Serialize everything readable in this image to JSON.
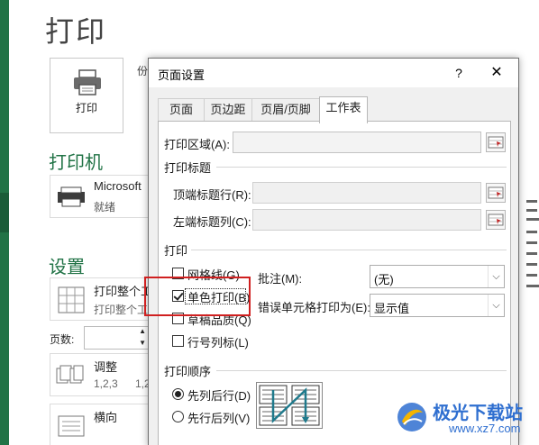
{
  "backstage": {
    "title": "打印",
    "print_button": "打印",
    "copies_label": "份",
    "printer_section": "打印机",
    "printer_name": "Microsoft",
    "printer_status": "就绪",
    "settings_section": "设置",
    "print_range_main": "打印整个工",
    "print_range_sub": "打印整个工",
    "pages_label": "页数:",
    "collate_main": "调整",
    "collate_sub": "1,2,3",
    "collate_sub2": "1,2",
    "orientation": "横向"
  },
  "dialog": {
    "title": "页面设置",
    "help_label": "?",
    "close_label": "✕",
    "tabs": [
      "页面",
      "页边距",
      "页眉/页脚",
      "工作表"
    ],
    "active_tab": "工作表",
    "print_area_label": "打印区域(A):",
    "print_titles_group": "打印标题",
    "rows_repeat_label": "顶端标题行(R):",
    "cols_repeat_label": "左端标题列(C):",
    "print_group": "打印",
    "gridlines_label": "网格线(G)",
    "gridlines_checked": false,
    "bw_label": "单色打印(B)",
    "bw_checked": true,
    "draft_label": "草稿品质(Q)",
    "draft_checked": false,
    "headings_label": "行号列标(L)",
    "headings_checked": false,
    "comments_label": "批注(M):",
    "comments_value": "(无)",
    "errors_label": "错误单元格打印为(E):",
    "errors_value": "显示值",
    "page_order_group": "打印顺序",
    "down_then_over": "先列后行(D)",
    "down_then_over_selected": true,
    "over_then_down": "先行后列(V)"
  },
  "watermark": {
    "name": "极光下载站",
    "url": "www.xz7.com"
  },
  "colors": {
    "excel_green": "#217346",
    "highlight_red": "#d02020",
    "watermark_blue": "#2f6fd0"
  }
}
